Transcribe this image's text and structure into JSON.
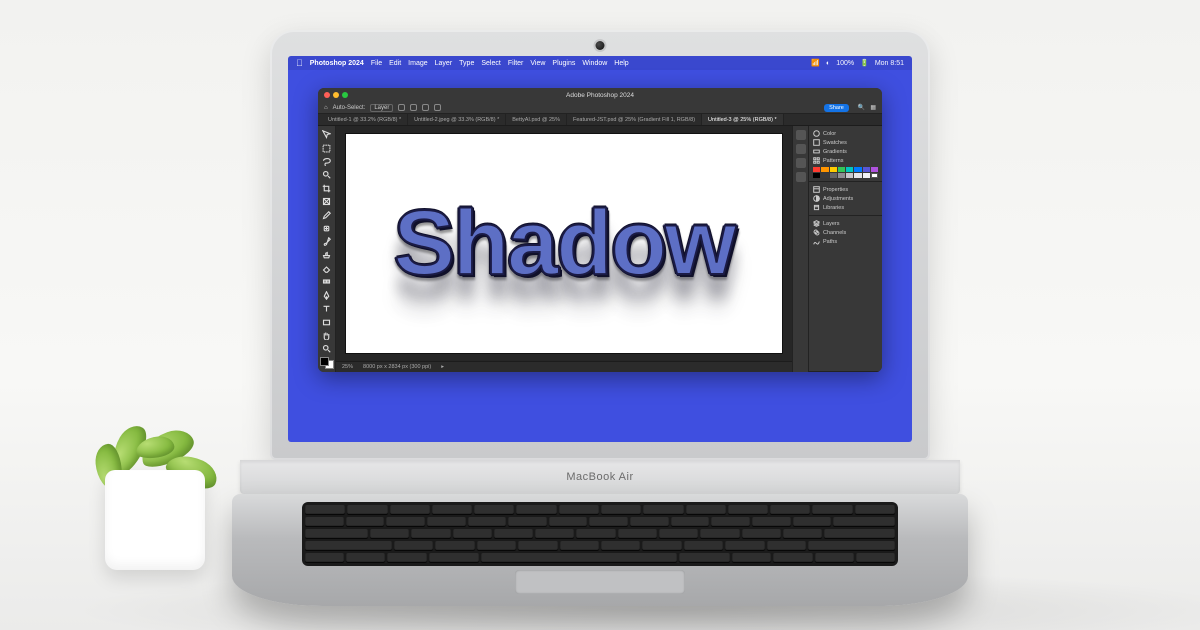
{
  "laptop_model": "MacBook Air",
  "macos": {
    "app_name": "Photoshop 2024",
    "menus": [
      "File",
      "Edit",
      "Image",
      "Layer",
      "Type",
      "Select",
      "Filter",
      "View",
      "Plugins",
      "Window",
      "Help"
    ],
    "right_status": [
      "100%",
      "Mon 8:51"
    ]
  },
  "photoshop": {
    "window_title": "Adobe Photoshop 2024",
    "options_bar": {
      "tool_label": "Auto-Select:",
      "tool_mode": "Layer",
      "share_label": "Share"
    },
    "tabs": [
      {
        "label": "Untitled-1 @ 33.2% (RGB/8) *",
        "active": false
      },
      {
        "label": "Untitled-2.jpeg @ 33.3% (RGB/8) *",
        "active": false
      },
      {
        "label": "BettyAI.psd @ 25%",
        "active": false
      },
      {
        "label": "Featured-JST.psd @ 25% (Gradient Fill 1, RGB/8)",
        "active": false
      },
      {
        "label": "Untitled-3 @ 25% (RGB/8) *",
        "active": true
      }
    ],
    "canvas_text": "Shadow",
    "status": {
      "zoom": "25%",
      "doc_info": "8000 px x 2834 px (300 ppi)"
    },
    "right_panels_top": [
      "Color",
      "Swatches",
      "Gradients",
      "Patterns"
    ],
    "right_panels_mid": [
      "Properties",
      "Adjustments",
      "Libraries"
    ],
    "right_panels_bot": [
      "Layers",
      "Channels",
      "Paths"
    ],
    "tool_names": [
      "move-tool",
      "marquee-tool",
      "lasso-tool",
      "quick-select-tool",
      "crop-tool",
      "frame-tool",
      "eyedropper-tool",
      "healing-brush-tool",
      "brush-tool",
      "clone-stamp-tool",
      "history-brush-tool",
      "eraser-tool",
      "gradient-tool",
      "blur-tool",
      "dodge-tool",
      "pen-tool",
      "type-tool",
      "path-select-tool",
      "rectangle-tool",
      "hand-tool",
      "zoom-tool",
      "edit-toolbar"
    ],
    "swatches": [
      "#ff3b30",
      "#ff9500",
      "#ffcc00",
      "#34c759",
      "#00c7be",
      "#007aff",
      "#5856d6",
      "#af52de",
      "#000000",
      "#3a3a3c",
      "#636366",
      "#8e8e93",
      "#c7c7cc",
      "#e5e5ea",
      "#f2f2f7",
      "#ffffff"
    ]
  },
  "wallpaper_color": "#3f4fe0",
  "text_color": "#5d6fc5"
}
